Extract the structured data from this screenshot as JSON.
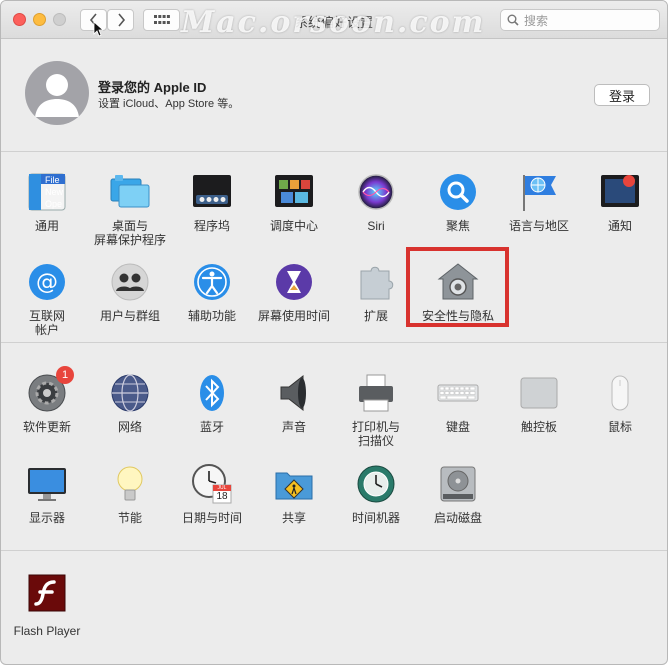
{
  "window": {
    "title": "系统偏好设置",
    "watermark": "Mac.orsoon.com",
    "search_placeholder": "搜索"
  },
  "account": {
    "title": "登录您的 Apple ID",
    "subtitle": "设置 iCloud、App Store 等。",
    "login_label": "登录"
  },
  "row1": [
    {
      "label": "通用",
      "icon": "general-icon"
    },
    {
      "label": "桌面与\n屏幕保护程序",
      "icon": "desktop-screensaver-icon"
    },
    {
      "label": "程序坞",
      "icon": "dock-icon"
    },
    {
      "label": "调度中心",
      "icon": "mission-control-icon"
    },
    {
      "label": "Siri",
      "icon": "siri-icon"
    },
    {
      "label": "聚焦",
      "icon": "spotlight-icon"
    },
    {
      "label": "语言与地区",
      "icon": "language-region-icon"
    },
    {
      "label": "通知",
      "icon": "notifications-icon"
    }
  ],
  "general_icon_text": "File\nNew\nOpe",
  "row2": [
    {
      "label": "互联网\n帐户",
      "icon": "internet-accounts-icon"
    },
    {
      "label": "用户与群组",
      "icon": "users-groups-icon"
    },
    {
      "label": "辅助功能",
      "icon": "accessibility-icon"
    },
    {
      "label": "屏幕使用时间",
      "icon": "screen-time-icon"
    },
    {
      "label": "扩展",
      "icon": "extensions-icon"
    },
    {
      "label": "安全性与隐私",
      "icon": "security-privacy-icon"
    }
  ],
  "row3": [
    {
      "label": "软件更新",
      "icon": "software-update-icon",
      "badge": "1"
    },
    {
      "label": "网络",
      "icon": "network-icon"
    },
    {
      "label": "蓝牙",
      "icon": "bluetooth-icon"
    },
    {
      "label": "声音",
      "icon": "sound-icon"
    },
    {
      "label": "打印机与\n扫描仪",
      "icon": "printers-scanners-icon"
    },
    {
      "label": "键盘",
      "icon": "keyboard-icon"
    },
    {
      "label": "触控板",
      "icon": "trackpad-icon"
    },
    {
      "label": "鼠标",
      "icon": "mouse-icon"
    }
  ],
  "row4": [
    {
      "label": "显示器",
      "icon": "displays-icon"
    },
    {
      "label": "节能",
      "icon": "energy-saver-icon"
    },
    {
      "label": "日期与时间",
      "icon": "date-time-icon"
    },
    {
      "label": "共享",
      "icon": "sharing-icon"
    },
    {
      "label": "时间机器",
      "icon": "time-machine-icon"
    },
    {
      "label": "启动磁盘",
      "icon": "startup-disk-icon"
    }
  ],
  "calendar_icon": {
    "month": "JUL",
    "day": "18"
  },
  "row5": [
    {
      "label": "Flash Player",
      "icon": "flash-player-icon"
    }
  ],
  "colors": {
    "highlight": "#d8322e",
    "badge": "#e8453c"
  }
}
